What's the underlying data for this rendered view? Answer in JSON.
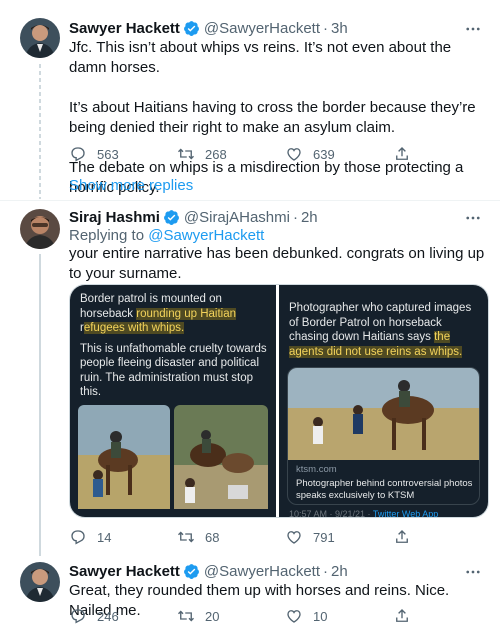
{
  "tweets": [
    {
      "name": "Sawyer Hackett",
      "handle": "@SawyerHackett",
      "dot": "·",
      "time": "3h",
      "body": [
        "Jfc. This isn’t about whips vs reins. It’s not even about the damn horses.",
        "It’s about Haitians having to cross the border because they’re being denied their right to make an asylum claim.",
        "The debate on whips is a misdirection by those protecting a horrific policy."
      ],
      "replies": "563",
      "retweets": "268",
      "likes": "639"
    },
    {
      "name": "Siraj Hashmi",
      "handle": "@SirajAHashmi",
      "dot": "·",
      "time": "2h",
      "replying_prefix": "Replying to",
      "replying_to": "@SawyerHackett",
      "body": [
        "your entire narrative has been debunked. congrats on living up to your surname."
      ],
      "replies": "14",
      "retweets": "68",
      "likes": "791"
    },
    {
      "name": "Sawyer Hackett",
      "handle": "@SawyerHackett",
      "dot": "·",
      "time": "2h",
      "body": [
        "Great, they rounded them up with horses and reins. Nice. Nailed me."
      ],
      "replies": "246",
      "retweets": "20",
      "likes": "10"
    }
  ],
  "show_more_replies": "Show more replies",
  "media": {
    "left": {
      "line1_a": "Border patrol is mounted on",
      "line2_a": "horseback ",
      "line2_hl": "rounding up Haitian",
      "line3_hl_a": "r",
      "line3_hl_b": "efugees with whips.",
      "para2": "This is unfathomable cruelty towards people fleeing disaster and political ruin. The administration must stop this."
    },
    "right": {
      "lines_a": "Photographer who captured images of Border Patrol on horseback chasing down Haitians says ",
      "hl": "the agents did not use reins as whips.",
      "card_domain": "ktsm.com",
      "card_title": "Photographer behind controversial photos speaks exclusively to KTSM",
      "timestamp": "10:57 AM · 9/21/21 · ",
      "via": "Twitter Web App"
    }
  },
  "colors": {
    "accent": "#1d9bf0",
    "secondary_text": "#536471",
    "dark_panel": "#15202b",
    "highlight": "#f3d35b"
  }
}
